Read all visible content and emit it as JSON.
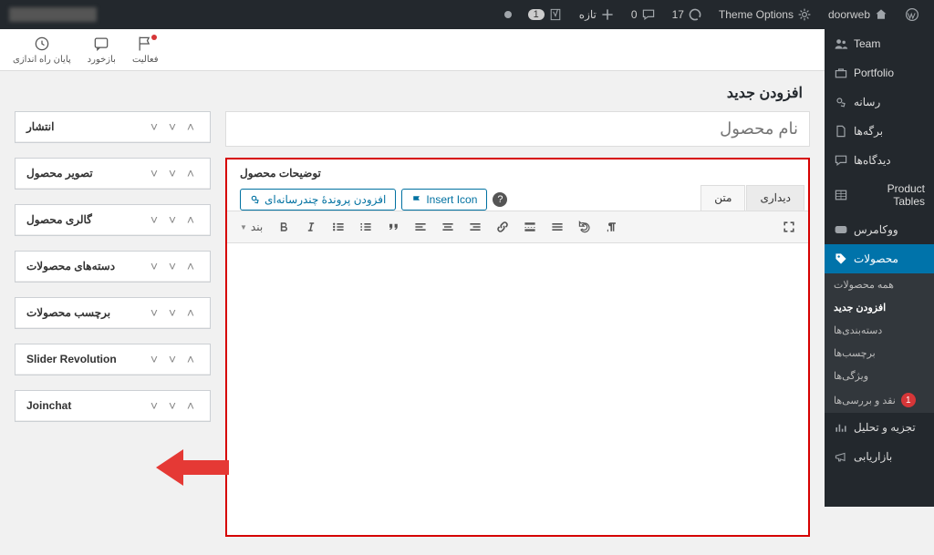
{
  "adminbar": {
    "left_blur": "howdy user",
    "right": {
      "wp_home": "doorweb",
      "theme_options": "Theme Options",
      "comments_count": "17",
      "comments_zero": "0",
      "new_label": "تازه",
      "notif_digit": "1"
    }
  },
  "sidemenu": {
    "items": [
      {
        "key": "team",
        "label": "Team"
      },
      {
        "key": "portfolio",
        "label": "Portfolio"
      },
      {
        "key": "media",
        "label": "رسانه"
      },
      {
        "key": "pages",
        "label": "برگه‌ها"
      },
      {
        "key": "comments",
        "label": "دیدگاه‌ها"
      },
      {
        "key": "ptables",
        "label": "Product Tables"
      }
    ],
    "woo": "ووکامرس",
    "products": "محصولات",
    "sub": [
      {
        "key": "all",
        "label": "همه محصولات"
      },
      {
        "key": "add",
        "label": "افزودن جدید",
        "cur": true
      },
      {
        "key": "cats",
        "label": "دسته‌بندی‌ها"
      },
      {
        "key": "tags",
        "label": "برچسب‌ها"
      },
      {
        "key": "attrs",
        "label": "ویژگی‌ها"
      },
      {
        "key": "reviews",
        "label": "نقد و بررسی‌ها",
        "badge": "1"
      }
    ],
    "bottom": [
      {
        "key": "analytics",
        "label": "تجزیه و تحلیل"
      },
      {
        "key": "marketing",
        "label": "بازاریابی"
      }
    ]
  },
  "toolbar": {
    "activity": "فعالیت",
    "feedback": "بازخورد",
    "finish": "پایان راه اندازی"
  },
  "page_title": "افزودن جدید",
  "title_placeholder": "نام محصول",
  "editor": {
    "panel_label": "توضیحات محصول",
    "media_btn": "افزودن پروندهٔ چندرسانه‌ای",
    "icon_btn": "Insert Icon",
    "tab_visual": "دیداری",
    "tab_text": "متن",
    "paragraph": "بند"
  },
  "metaboxes": [
    "انتشار",
    "تصویر محصول",
    "گالری محصول",
    "دسته‌های محصولات",
    "برچسب محصولات",
    "Slider Revolution",
    "Joinchat"
  ],
  "chart_data": null
}
